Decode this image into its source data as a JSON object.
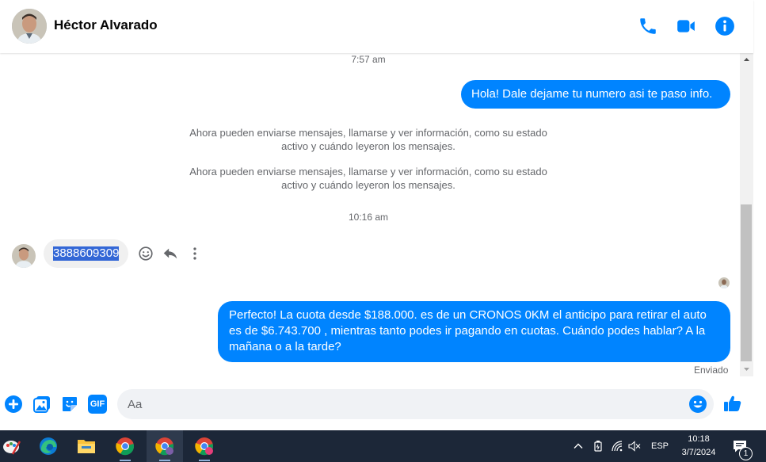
{
  "header": {
    "contact_name": "Héctor Alvarado",
    "icons": [
      "phone-icon",
      "video-call-icon",
      "info-icon"
    ],
    "accent_color": "#0084ff"
  },
  "conversation": {
    "timestamp_1": "7:57 am",
    "outgoing_1": "Hola! Dale dejame tu numero  asi te paso info.",
    "system_1_line1": "Ahora pueden enviarse mensajes, llamarse y ver información, como su estado",
    "system_1_line2": "activo y cuándo leyeron los mensajes.",
    "system_2_line1": "Ahora pueden enviarse mensajes, llamarse y ver información, como su estado",
    "system_2_line2": "activo y cuándo leyeron los mensajes.",
    "timestamp_2": "10:16 am",
    "incoming_1": "3888609309",
    "outgoing_2_line1": "Perfecto! La cuota desde $188.000. es de un CRONOS 0KM el anticipo para retirar el auto",
    "outgoing_2_line2": "es de $6.743.700 , mientras tanto podes ir pagando en cuotas. Cuándo podes hablar? A la",
    "outgoing_2_line3": "mañana o a la tarde?",
    "delivery_status": "Enviado"
  },
  "composer": {
    "placeholder": "Aa",
    "icons": [
      "add-icon",
      "photo-icon",
      "sticker-icon",
      "gif-icon",
      "emoji-icon",
      "like-icon"
    ],
    "gif_label": "GIF"
  },
  "taskbar": {
    "language": "ESP",
    "time": "10:18",
    "date": "3/7/2024",
    "notification_count": "1",
    "apps": [
      "paint-icon",
      "edge-icon",
      "file-explorer-icon",
      "chrome-icon",
      "chrome-profile-icon",
      "chrome-profile-c-icon"
    ]
  }
}
